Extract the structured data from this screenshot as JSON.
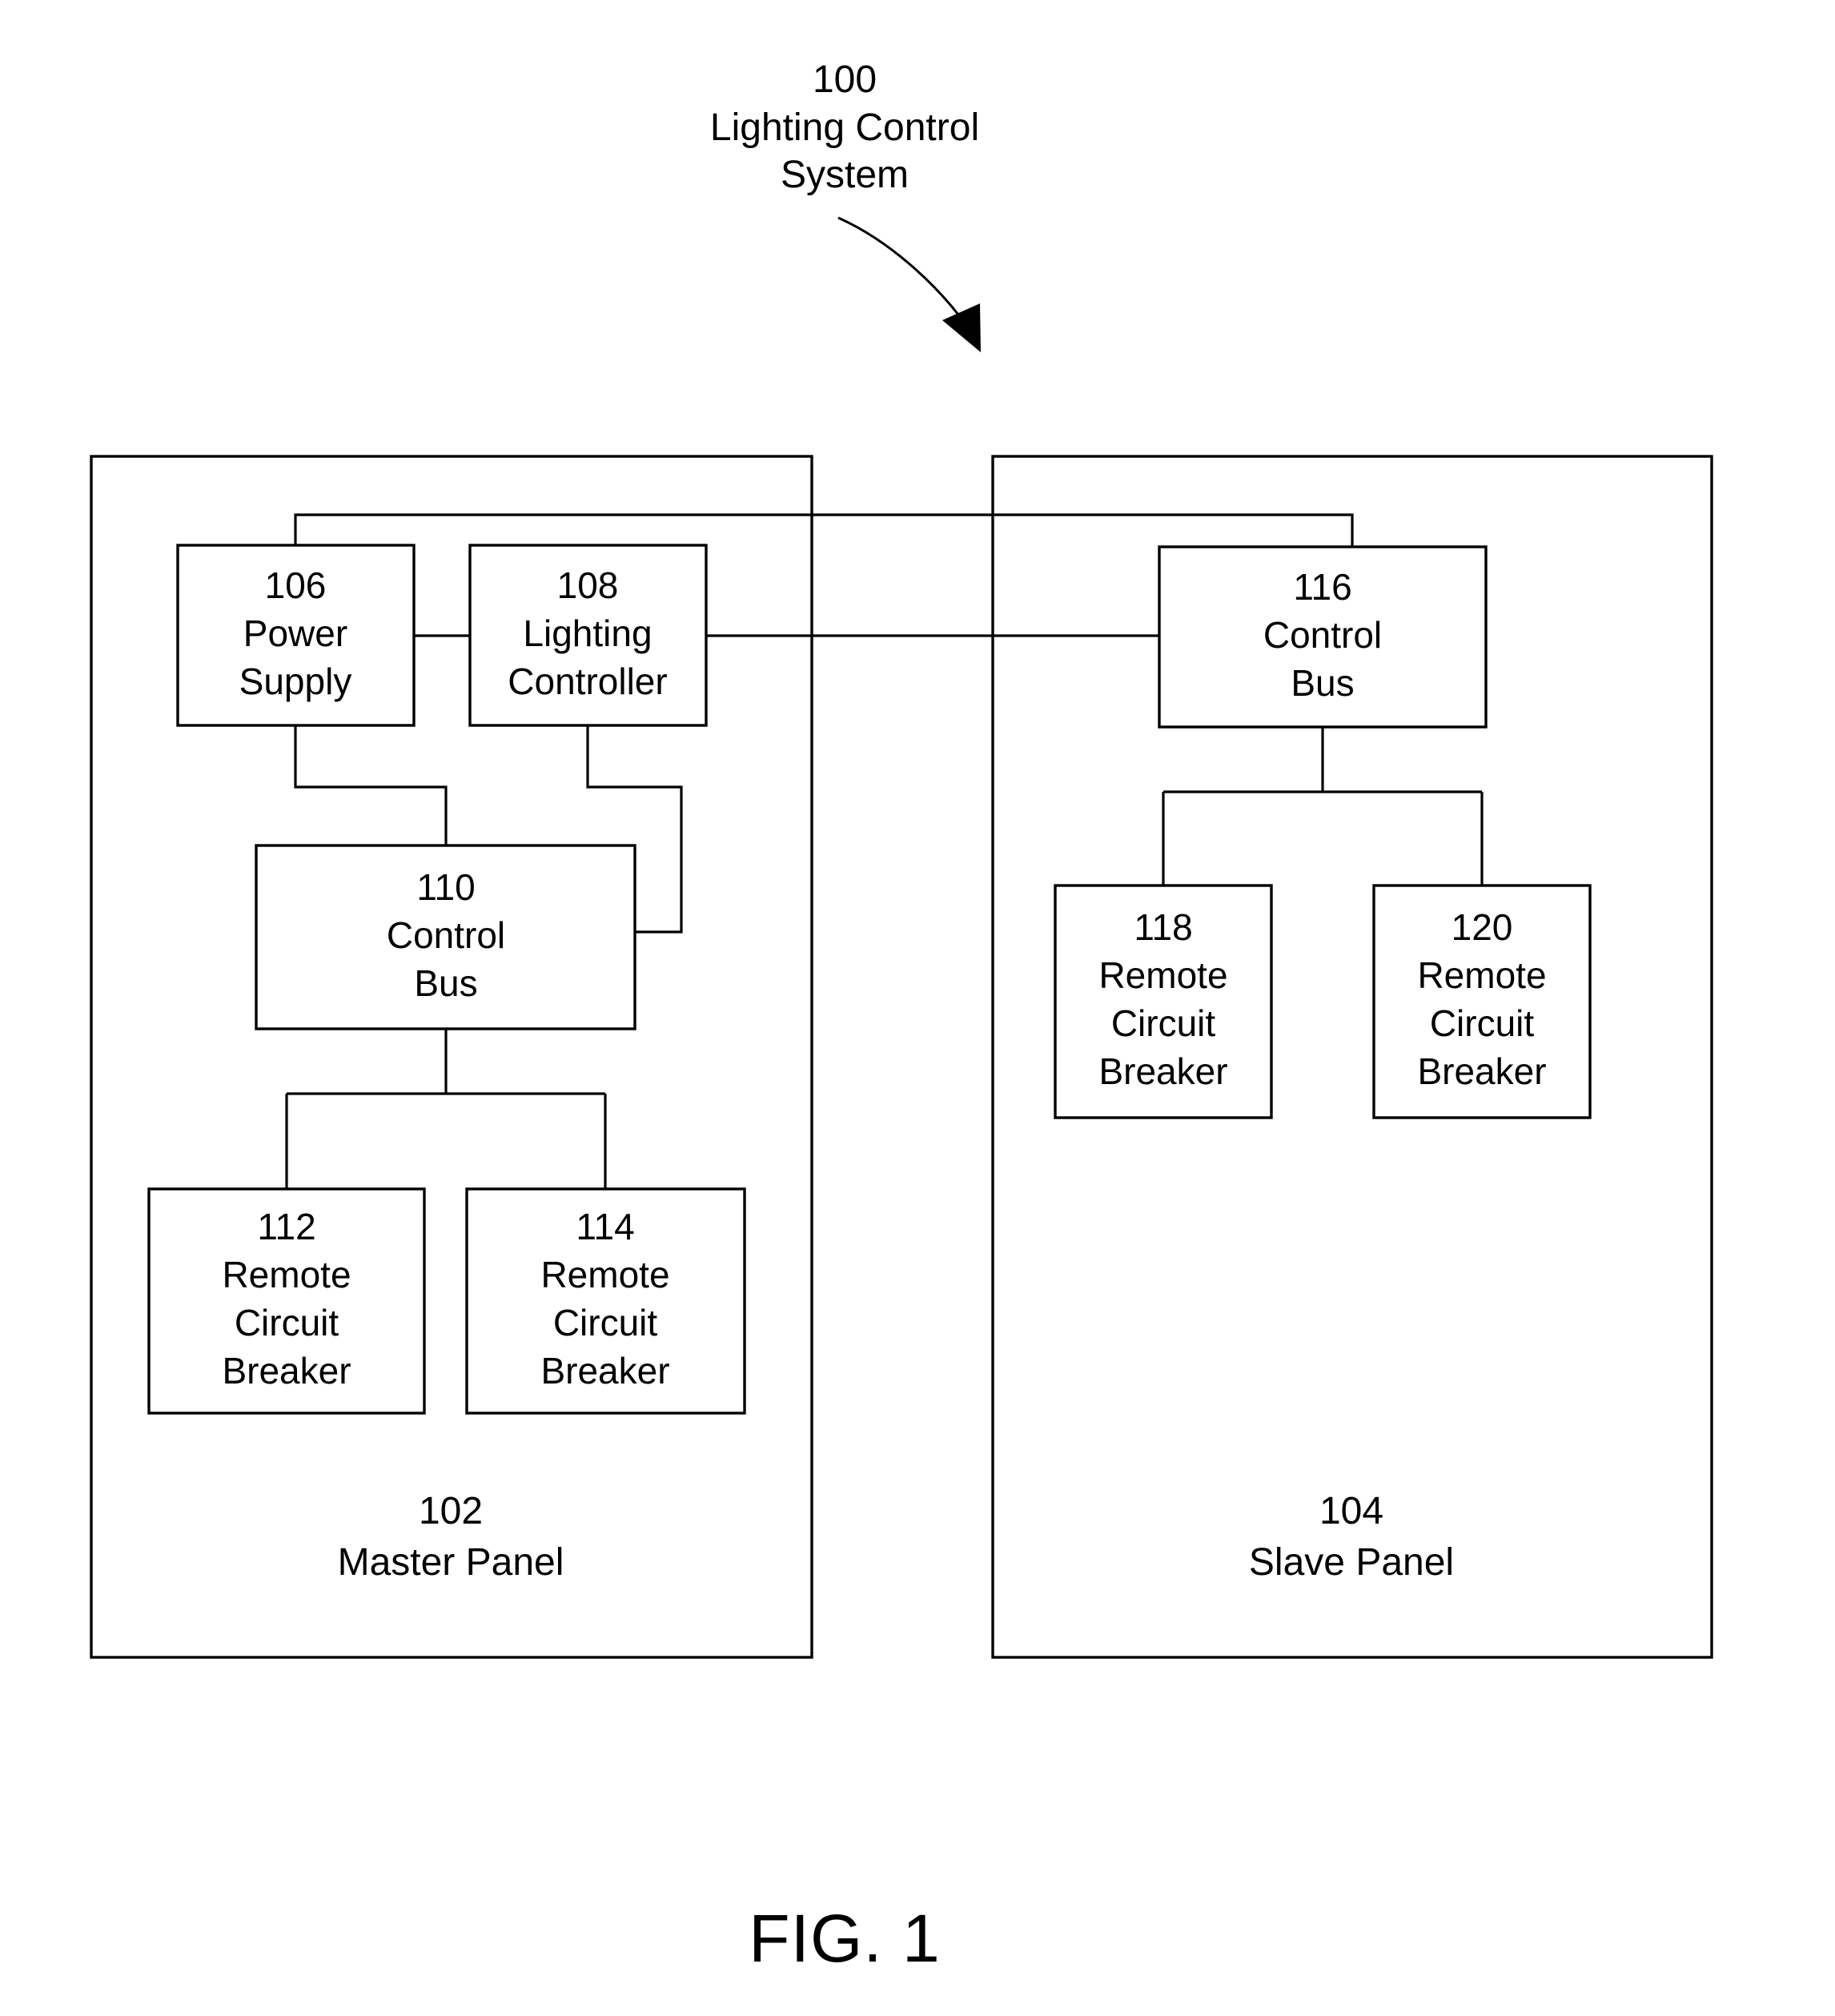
{
  "figure": {
    "caption": "FIG. 1",
    "title_ref": "100",
    "title_line1": "Lighting Control",
    "title_line2": "System"
  },
  "panels": [
    {
      "id": "master-panel",
      "ref": "102",
      "label": "Master Panel"
    },
    {
      "id": "slave-panel",
      "ref": "104",
      "label": "Slave Panel"
    }
  ],
  "blocks": [
    {
      "id": "power-supply",
      "ref": "106",
      "line1": "Power",
      "line2": "Supply",
      "line3": ""
    },
    {
      "id": "lighting-controller",
      "ref": "108",
      "line1": "Lighting",
      "line2": "Controller",
      "line3": ""
    },
    {
      "id": "control-bus-master",
      "ref": "110",
      "line1": "Control",
      "line2": "Bus",
      "line3": ""
    },
    {
      "id": "remote-circuit-breaker-112",
      "ref": "112",
      "line1": "Remote",
      "line2": "Circuit",
      "line3": "Breaker"
    },
    {
      "id": "remote-circuit-breaker-114",
      "ref": "114",
      "line1": "Remote",
      "line2": "Circuit",
      "line3": "Breaker"
    },
    {
      "id": "control-bus-slave",
      "ref": "116",
      "line1": "Control",
      "line2": "Bus",
      "line3": ""
    },
    {
      "id": "remote-circuit-breaker-118",
      "ref": "118",
      "line1": "Remote",
      "line2": "Circuit",
      "line3": "Breaker"
    },
    {
      "id": "remote-circuit-breaker-120",
      "ref": "120",
      "line1": "Remote",
      "line2": "Circuit",
      "line3": "Breaker"
    }
  ],
  "colors": {
    "stroke": "#000000",
    "background": "#ffffff"
  }
}
